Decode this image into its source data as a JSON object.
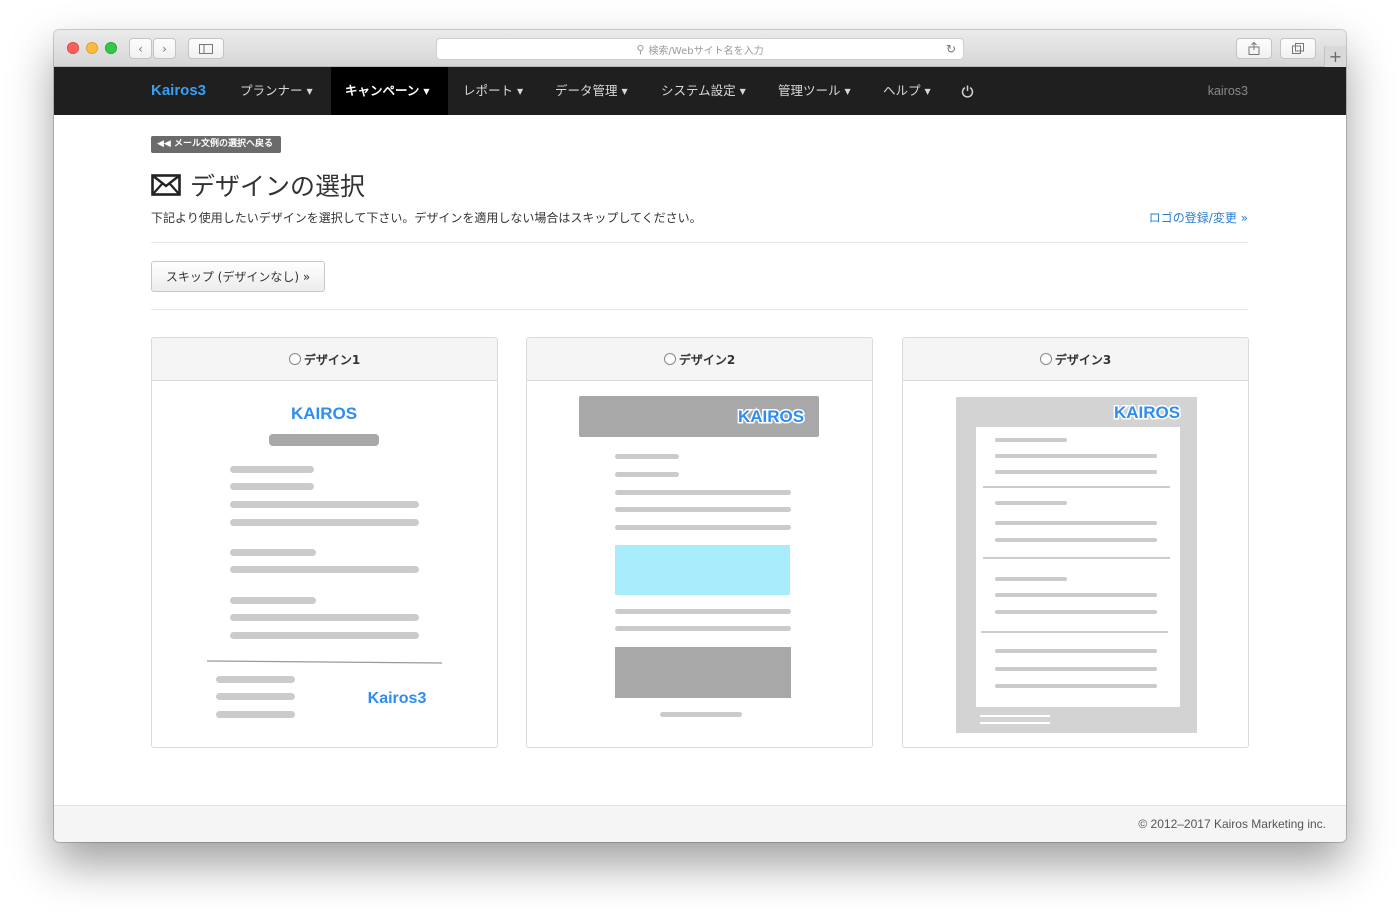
{
  "browser": {
    "address_placeholder": "検索/Webサイト名を入力",
    "icons": [
      "back-icon",
      "forward-icon",
      "sidebar-icon",
      "search-icon",
      "reload-icon",
      "share-icon",
      "tabs-icon",
      "new-tab-icon"
    ]
  },
  "nav": {
    "brand": "Kairos3",
    "items": [
      {
        "label": "プランナー"
      },
      {
        "label": "キャンペーン"
      },
      {
        "label": "レポート"
      },
      {
        "label": "データ管理"
      },
      {
        "label": "システム設定"
      },
      {
        "label": "管理ツール"
      },
      {
        "label": "ヘルプ"
      }
    ],
    "active_index": 1,
    "user": "kairos3"
  },
  "page": {
    "back_label": "メール文例の選択へ戻る",
    "title": "デザインの選択",
    "description": "下記より使用したいデザインを選択して下さい。デザインを適用しない場合はスキップしてください。",
    "logo_link": "ロゴの登録/変更 »",
    "skip_label": "スキップ (デザインなし) »"
  },
  "designs": [
    {
      "label": "デザイン1",
      "logo_text": "KAIROS",
      "footer_logo": "Kairos3"
    },
    {
      "label": "デザイン2",
      "logo_text": "KAIROS"
    },
    {
      "label": "デザイン3",
      "logo_text": "KAIROS"
    }
  ],
  "colors": {
    "navbar": "#1f1f1f",
    "brand": "#3a9ef5",
    "link": "#2a7fd0",
    "logo_blue": "#2e8df0",
    "placeholder_gray": "#a8a8a8",
    "highlight_cyan": "#a9ecfc"
  },
  "footer": {
    "copyright": "© 2012–2017 Kairos Marketing inc."
  }
}
